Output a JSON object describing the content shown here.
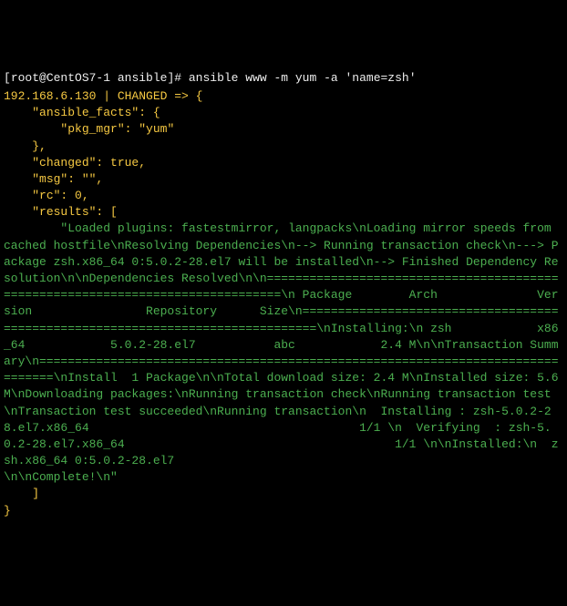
{
  "prompt_user": "root@CentOS7-1",
  "prompt_path": "ansible",
  "prompt_symbol": "]# ",
  "command": "ansible www -m yum -a 'name=zsh'",
  "host_line": "192.168.6.130 | CHANGED => {",
  "json_lines": {
    "ansible_facts_open": "    \"ansible_facts\": {",
    "pkg_mgr": "        \"pkg_mgr\": \"yum\"",
    "ansible_facts_close": "    },",
    "changed": "    \"changed\": true,",
    "msg": "    \"msg\": \"\",",
    "rc": "    \"rc\": 0,",
    "results_open": "    \"results\": [",
    "results_text": "        \"Loaded plugins: fastestmirror, langpacks\\nLoading mirror speeds from cached hostfile\\nResolving Dependencies\\n--> Running transaction check\\n---> Package zsh.x86_64 0:5.0.2-28.el7 will be installed\\n--> Finished Dependency Resolution\\n\\nDependencies Resolved\\n\\n================================================================================\\n Package        Arch              Version                Repository      Size\\n================================================================================\\nInstalling:\\n zsh            x86_64            5.0.2-28.el7           abc            2.4 M\\n\\nTransaction Summary\\n================================================================================\\nInstall  1 Package\\n\\nTotal download size: 2.4 M\\nInstalled size: 5.6 M\\nDownloading packages:\\nRunning transaction check\\nRunning transaction test\\nTransaction test succeeded\\nRunning transaction\\n  Installing : zsh-5.0.2-28.el7.x86_64                                      1/1 \\n  Verifying  : zsh-5.0.2-28.el7.x86_64                                      1/1 \\n\\nInstalled:\\n  zsh.x86_64 0:5.0.2-28.el7                                                     \\n\\nComplete!\\n\"",
    "results_close": "    ]",
    "json_close": "}"
  }
}
